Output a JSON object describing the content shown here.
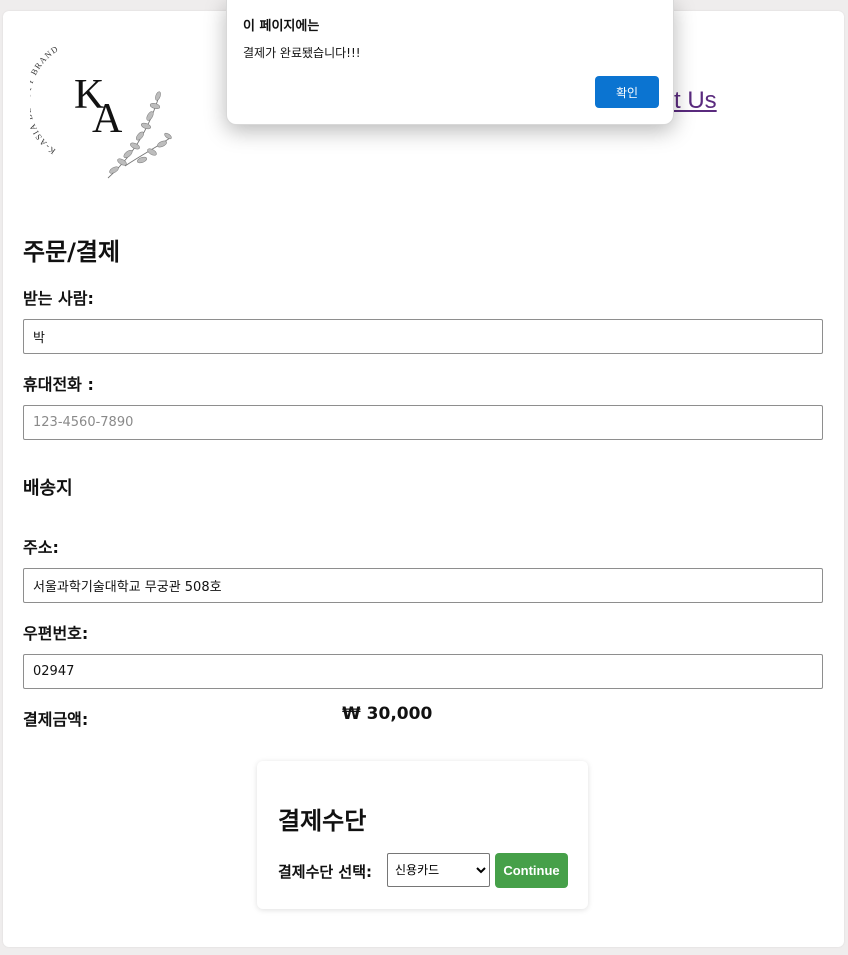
{
  "header": {
    "brand_arc": "K-ASIA BEAUTY BRAND",
    "monogram_k": "K",
    "monogram_a": "A",
    "contact_link": "t Us"
  },
  "form": {
    "title": "주문/결제",
    "recipient_label": "받는 사람:",
    "recipient_value": "박",
    "phone_label": "휴대전화 :",
    "phone_placeholder": "123-4560-7890",
    "shipping_title": "배송지",
    "address_label": "주소:",
    "address_value": "서울과학기술대학교 무궁관 508호",
    "zip_label": "우편번호:",
    "zip_value": "02947",
    "amount_label": "결제금액:",
    "amount_value": "₩ 30,000"
  },
  "payment": {
    "title": "결제수단",
    "select_label": "결제수단 선택:",
    "selected_method": "신용카드",
    "continue_label": "Continue"
  },
  "dialog": {
    "title": "이 페이지에는",
    "message": "결제가 완료됐습니다!!!",
    "ok_label": "확인"
  },
  "colors": {
    "continue_button": "#46a049",
    "dialog_ok_button": "#0b74d1",
    "link": "#5a2a7e",
    "page_background": "#efeded"
  }
}
